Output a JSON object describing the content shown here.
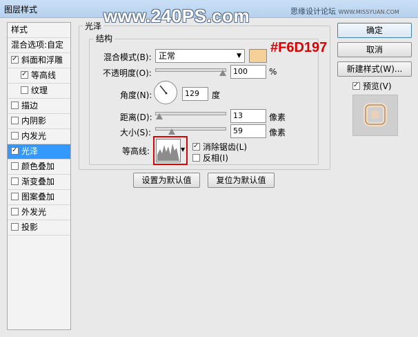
{
  "window": {
    "title": "图层样式"
  },
  "watermark": {
    "main": "www.240PS.com",
    "side": "思缘设计论坛",
    "side_small": "WWW.MISSYUAN.COM"
  },
  "style_list": {
    "header": "样式",
    "blend_options": "混合选项:自定",
    "items": [
      {
        "label": "斜面和浮雕",
        "checked": true
      },
      {
        "label": "等高线",
        "checked": true
      },
      {
        "label": "纹理",
        "checked": false
      },
      {
        "label": "描边",
        "checked": false
      },
      {
        "label": "内阴影",
        "checked": false
      },
      {
        "label": "内发光",
        "checked": false
      },
      {
        "label": "光泽",
        "checked": true
      },
      {
        "label": "颜色叠加",
        "checked": false
      },
      {
        "label": "渐变叠加",
        "checked": false
      },
      {
        "label": "图案叠加",
        "checked": false
      },
      {
        "label": "外发光",
        "checked": false
      },
      {
        "label": "投影",
        "checked": false
      }
    ]
  },
  "panel": {
    "title": "光泽",
    "structure_title": "结构",
    "blend_mode_label": "混合模式(B):",
    "blend_mode_value": "正常",
    "color_hex": "#F6D197",
    "color_annotation": "#F6D197",
    "opacity_label": "不透明度(O):",
    "opacity_value": "100",
    "opacity_unit": "%",
    "angle_label": "角度(N):",
    "angle_value": "129",
    "angle_unit": "度",
    "distance_label": "距离(D):",
    "distance_value": "13",
    "distance_unit": "像素",
    "size_label": "大小(S):",
    "size_value": "59",
    "size_unit": "像素",
    "contour_label": "等高线:",
    "anti_alias_label": "消除锯齿(L)",
    "anti_alias_checked": true,
    "invert_label": "反相(I)",
    "invert_checked": false,
    "set_default_button": "设置为默认值",
    "reset_default_button": "复位为默认值"
  },
  "buttons": {
    "ok": "确定",
    "cancel": "取消",
    "new_style": "新建样式(W)...",
    "preview_label": "预览(V)",
    "preview_checked": true
  }
}
